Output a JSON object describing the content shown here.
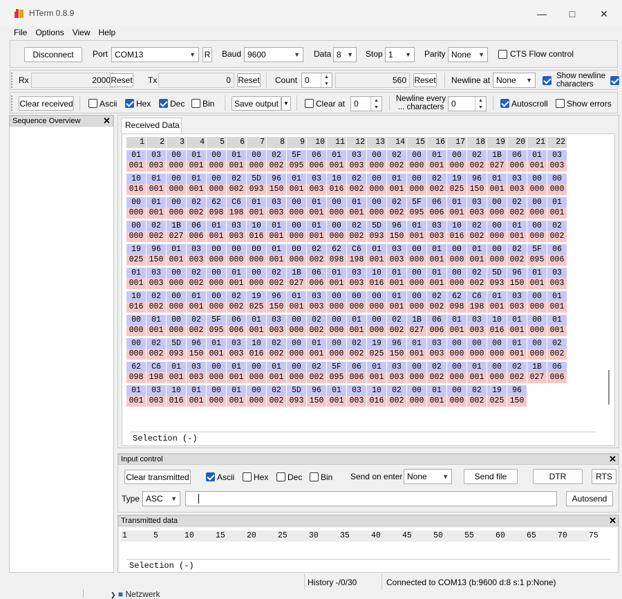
{
  "window": {
    "title": "HTerm 0.8.9"
  },
  "menu": [
    "File",
    "Options",
    "View",
    "Help"
  ],
  "connection": {
    "disconnect_label": "Disconnect",
    "port_label": "Port",
    "port_value": "COM13",
    "r_label": "R",
    "baud_label": "Baud",
    "baud_value": "9600",
    "data_label": "Data",
    "data_value": "8",
    "stop_label": "Stop",
    "stop_value": "1",
    "parity_label": "Parity",
    "parity_value": "None",
    "cts_label": "CTS Flow control"
  },
  "counters": {
    "rx_label": "Rx",
    "rx_value": "2000",
    "rx_reset": "Reset",
    "tx_label": "Tx",
    "tx_value": "0",
    "tx_reset": "Reset",
    "count_label": "Count",
    "count_value": "0",
    "count_total": "560",
    "count_reset": "Reset",
    "newline_label": "Newline at",
    "newline_value": "None",
    "show_newline_label": "Show newline characters"
  },
  "display": {
    "clear_received": "Clear received",
    "ascii": "Ascii",
    "hex": "Hex",
    "dec": "Dec",
    "bin": "Bin",
    "save_output": "Save output",
    "clear_at": "Clear at",
    "clear_at_value": "0",
    "newline_every": "Newline every ... characters",
    "newline_every_value": "0",
    "autoscroll": "Autoscroll",
    "show_errors": "Show errors"
  },
  "sequence_overview": {
    "title": "Sequence Overview",
    "close": "✕"
  },
  "received": {
    "tab": "Received Data",
    "selection": "Selection (-)",
    "headers": [
      "1",
      "2",
      "3",
      "4",
      "5",
      "6",
      "7",
      "8",
      "9",
      "10",
      "11",
      "12",
      "13",
      "14",
      "15",
      "16",
      "17",
      "18",
      "19",
      "20",
      "21",
      "22"
    ],
    "rows": [
      {
        "hex": [
          "01",
          "03",
          "00",
          "01",
          "00",
          "01",
          "00",
          "02",
          "5F",
          "06",
          "01",
          "03",
          "00",
          "02",
          "00",
          "01",
          "00",
          "02",
          "1B",
          "06",
          "01",
          "03"
        ],
        "dec": [
          "001",
          "003",
          "000",
          "001",
          "000",
          "001",
          "000",
          "002",
          "095",
          "006",
          "001",
          "003",
          "000",
          "002",
          "000",
          "001",
          "000",
          "002",
          "027",
          "006",
          "001",
          "003"
        ]
      },
      {
        "hex": [
          "10",
          "01",
          "00",
          "01",
          "00",
          "02",
          "5D",
          "96",
          "01",
          "03",
          "10",
          "02",
          "00",
          "01",
          "00",
          "02",
          "19",
          "96",
          "01",
          "03",
          "00",
          "00"
        ],
        "dec": [
          "016",
          "001",
          "000",
          "001",
          "000",
          "002",
          "093",
          "150",
          "001",
          "003",
          "016",
          "002",
          "000",
          "001",
          "000",
          "002",
          "025",
          "150",
          "001",
          "003",
          "000",
          "000"
        ]
      },
      {
        "hex": [
          "00",
          "01",
          "00",
          "02",
          "62",
          "C6",
          "01",
          "03",
          "00",
          "01",
          "00",
          "01",
          "00",
          "02",
          "5F",
          "06",
          "01",
          "03",
          "00",
          "02",
          "00",
          "01"
        ],
        "dec": [
          "000",
          "001",
          "000",
          "002",
          "098",
          "198",
          "001",
          "003",
          "000",
          "001",
          "000",
          "001",
          "000",
          "002",
          "095",
          "006",
          "001",
          "003",
          "000",
          "002",
          "000",
          "001"
        ]
      },
      {
        "hex": [
          "00",
          "02",
          "1B",
          "06",
          "01",
          "03",
          "10",
          "01",
          "00",
          "01",
          "00",
          "02",
          "5D",
          "96",
          "01",
          "03",
          "10",
          "02",
          "00",
          "01",
          "00",
          "02"
        ],
        "dec": [
          "000",
          "002",
          "027",
          "006",
          "001",
          "003",
          "016",
          "001",
          "000",
          "001",
          "000",
          "002",
          "093",
          "150",
          "001",
          "003",
          "016",
          "002",
          "000",
          "001",
          "000",
          "002"
        ]
      },
      {
        "hex": [
          "19",
          "96",
          "01",
          "03",
          "00",
          "00",
          "00",
          "01",
          "00",
          "02",
          "62",
          "C6",
          "01",
          "03",
          "00",
          "01",
          "00",
          "01",
          "00",
          "02",
          "5F",
          "06"
        ],
        "dec": [
          "025",
          "150",
          "001",
          "003",
          "000",
          "000",
          "000",
          "001",
          "000",
          "002",
          "098",
          "198",
          "001",
          "003",
          "000",
          "001",
          "000",
          "001",
          "000",
          "002",
          "095",
          "006"
        ]
      },
      {
        "hex": [
          "01",
          "03",
          "00",
          "02",
          "00",
          "01",
          "00",
          "02",
          "1B",
          "06",
          "01",
          "03",
          "10",
          "01",
          "00",
          "01",
          "00",
          "02",
          "5D",
          "96",
          "01",
          "03"
        ],
        "dec": [
          "001",
          "003",
          "000",
          "002",
          "000",
          "001",
          "000",
          "002",
          "027",
          "006",
          "001",
          "003",
          "016",
          "001",
          "000",
          "001",
          "000",
          "002",
          "093",
          "150",
          "001",
          "003"
        ]
      },
      {
        "hex": [
          "10",
          "02",
          "00",
          "01",
          "00",
          "02",
          "19",
          "96",
          "01",
          "03",
          "00",
          "00",
          "00",
          "01",
          "00",
          "02",
          "62",
          "C6",
          "01",
          "03",
          "00",
          "01"
        ],
        "dec": [
          "016",
          "002",
          "000",
          "001",
          "000",
          "002",
          "025",
          "150",
          "001",
          "003",
          "000",
          "000",
          "000",
          "001",
          "000",
          "002",
          "098",
          "198",
          "001",
          "003",
          "000",
          "001"
        ]
      },
      {
        "hex": [
          "00",
          "01",
          "00",
          "02",
          "5F",
          "06",
          "01",
          "03",
          "00",
          "02",
          "00",
          "01",
          "00",
          "02",
          "1B",
          "06",
          "01",
          "03",
          "10",
          "01",
          "00",
          "01"
        ],
        "dec": [
          "000",
          "001",
          "000",
          "002",
          "095",
          "006",
          "001",
          "003",
          "000",
          "002",
          "000",
          "001",
          "000",
          "002",
          "027",
          "006",
          "001",
          "003",
          "016",
          "001",
          "000",
          "001"
        ]
      },
      {
        "hex": [
          "00",
          "02",
          "5D",
          "96",
          "01",
          "03",
          "10",
          "02",
          "00",
          "01",
          "00",
          "02",
          "19",
          "96",
          "01",
          "03",
          "00",
          "00",
          "00",
          "01",
          "00",
          "02"
        ],
        "dec": [
          "000",
          "002",
          "093",
          "150",
          "001",
          "003",
          "016",
          "002",
          "000",
          "001",
          "000",
          "002",
          "025",
          "150",
          "001",
          "003",
          "000",
          "000",
          "000",
          "001",
          "000",
          "002"
        ]
      },
      {
        "hex": [
          "62",
          "C6",
          "01",
          "03",
          "00",
          "01",
          "00",
          "01",
          "00",
          "02",
          "5F",
          "06",
          "01",
          "03",
          "00",
          "02",
          "00",
          "01",
          "00",
          "02",
          "1B",
          "06"
        ],
        "dec": [
          "098",
          "198",
          "001",
          "003",
          "000",
          "001",
          "000",
          "001",
          "000",
          "002",
          "095",
          "006",
          "001",
          "003",
          "000",
          "002",
          "000",
          "001",
          "000",
          "002",
          "027",
          "006"
        ]
      },
      {
        "hex": [
          "01",
          "03",
          "10",
          "01",
          "00",
          "01",
          "00",
          "02",
          "5D",
          "96",
          "01",
          "03",
          "10",
          "02",
          "00",
          "01",
          "00",
          "02",
          "19",
          "96"
        ],
        "dec": [
          "001",
          "003",
          "016",
          "001",
          "000",
          "001",
          "000",
          "002",
          "093",
          "150",
          "001",
          "003",
          "016",
          "002",
          "000",
          "001",
          "000",
          "002",
          "025",
          "150"
        ]
      }
    ]
  },
  "input_control": {
    "title": "Input control",
    "close": "✕",
    "clear_transmitted": "Clear transmitted",
    "ascii": "Ascii",
    "hex": "Hex",
    "dec": "Dec",
    "bin": "Bin",
    "send_on_enter": "Send on enter",
    "send_on_enter_value": "None",
    "send_file": "Send file",
    "dtr": "DTR",
    "rts": "RTS",
    "type_label": "Type",
    "type_value": "ASC",
    "input_value": "",
    "autosend": "Autosend"
  },
  "transmitted": {
    "title": "Transmitted data",
    "close": "✕",
    "ruler": [
      "1",
      "5",
      "10",
      "15",
      "20",
      "25",
      "30",
      "35",
      "40",
      "45",
      "50",
      "55",
      "60",
      "65",
      "70",
      "75"
    ],
    "selection": "Selection (-)"
  },
  "status": {
    "history": "History -/0/30",
    "connected": "Connected to COM13 (b:9600 d:8 s:1 p:None)"
  },
  "background_text": "Netzwerk"
}
